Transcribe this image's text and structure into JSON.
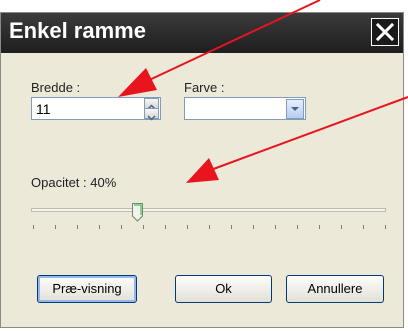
{
  "dialog": {
    "title": "Enkel ramme",
    "close_icon": "close-icon"
  },
  "width": {
    "label": "Bredde :",
    "value": "11"
  },
  "color": {
    "label": "Farve :",
    "value": ""
  },
  "opacity": {
    "label": "Opacitet : 40%",
    "value_percent": 40
  },
  "buttons": {
    "preview": "Præ-visning",
    "ok": "Ok",
    "cancel": "Annullere"
  },
  "annotation_color": "#e8141e",
  "accent": "#003c74"
}
